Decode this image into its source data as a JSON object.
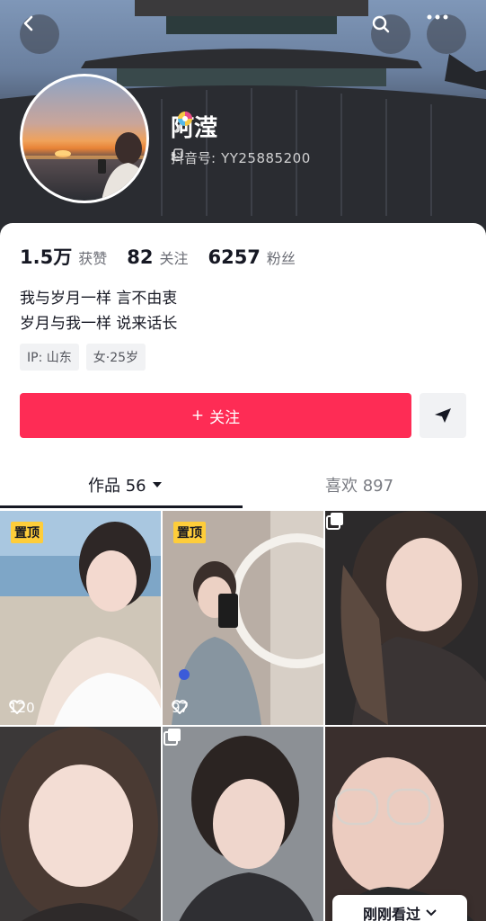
{
  "header": {
    "nickname": "阿滢",
    "douyin_id_label": "抖音号:",
    "douyin_id": "YY25885200",
    "icons": [
      "back-icon",
      "search-icon",
      "more-icon",
      "copy-icon",
      "lollipop-emoji"
    ]
  },
  "stats": [
    {
      "value": "1.5万",
      "label": "获赞"
    },
    {
      "value": "82",
      "label": "关注"
    },
    {
      "value": "6257",
      "label": "粉丝"
    }
  ],
  "bio": [
    "我与岁月一样 言不由衷",
    "岁月与我一样 说来话长"
  ],
  "tags": [
    "IP: 山东",
    "女·25岁"
  ],
  "actions": {
    "follow_label": "关注",
    "follow_prefix": "+"
  },
  "tabs": {
    "works_label": "作品 56",
    "likes_label": "喜欢 897"
  },
  "videos": [
    {
      "pinned": true,
      "pin_label": "置顶",
      "likes": "120"
    },
    {
      "pinned": true,
      "pin_label": "置顶",
      "likes": "97"
    },
    {
      "pinned": false,
      "multi": true
    },
    {
      "pinned": false
    },
    {
      "pinned": false,
      "multi": true
    },
    {
      "pinned": false
    }
  ],
  "toast": {
    "label": "刚刚看过"
  },
  "colors": {
    "accent": "#fe2c55",
    "pin": "#fecd3a",
    "text": "#161823",
    "muted": "#6b6d75"
  }
}
